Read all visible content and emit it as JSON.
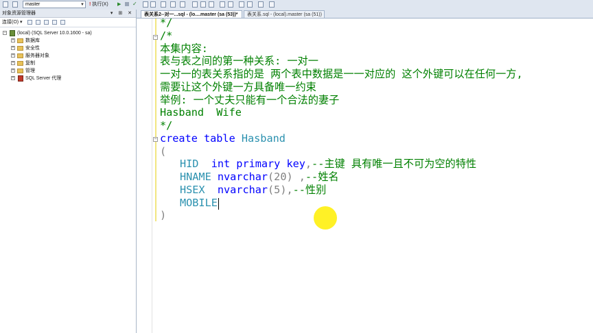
{
  "toolbar": {
    "database": "master",
    "execute_label": "执行(X)"
  },
  "object_explorer": {
    "title": "对象资源管理器",
    "connect_label": "连接(O) ▾",
    "title_controls": "▾ ⊞ ✕",
    "server_node": "(local) (SQL Server 10.0.1600 - sa)",
    "nodes": [
      "数据库",
      "安全性",
      "服务器对象",
      "复制",
      "管理",
      "SQL Server 代理"
    ]
  },
  "tabs": [
    {
      "label": "表关系2--对一...sql - (lo....master (sa (53))*",
      "active": true
    },
    {
      "label": "表关系.sql - (local).master (sa (51))",
      "active": false
    }
  ],
  "editor": {
    "lines": {
      "l1": "*/",
      "l2": "/*",
      "l3": "本集内容:",
      "l4": "表与表之间的第一种关系: 一对一",
      "l5": "一对一的表关系指的是 两个表中数据是一一对应的 这个外键可以在任何一方,",
      "l6": "需要让这个外键一方具备唯一约束",
      "l7": "举例: 一个丈夫只能有一个合法的妻子",
      "l8": "Hasband  Wife",
      "l9": "*/",
      "l10_kw": "create table",
      "l10_name": " Hasband",
      "l11": "(",
      "l12_col": "HID",
      "l12_type": "int primary key",
      "l12_rest": ",",
      "l12_comment": "--主键 具有唯一且不可为空的特性",
      "l13_col": "HNAME",
      "l13_type": "nvarchar",
      "l13_args": "(20) ,",
      "l13_comment": "--姓名",
      "l14_col": "HSEX",
      "l14_type": "nvarchar",
      "l14_args": "(5),",
      "l14_comment": "--性别",
      "l15_col": "MOBILE",
      "l16": ")"
    }
  }
}
